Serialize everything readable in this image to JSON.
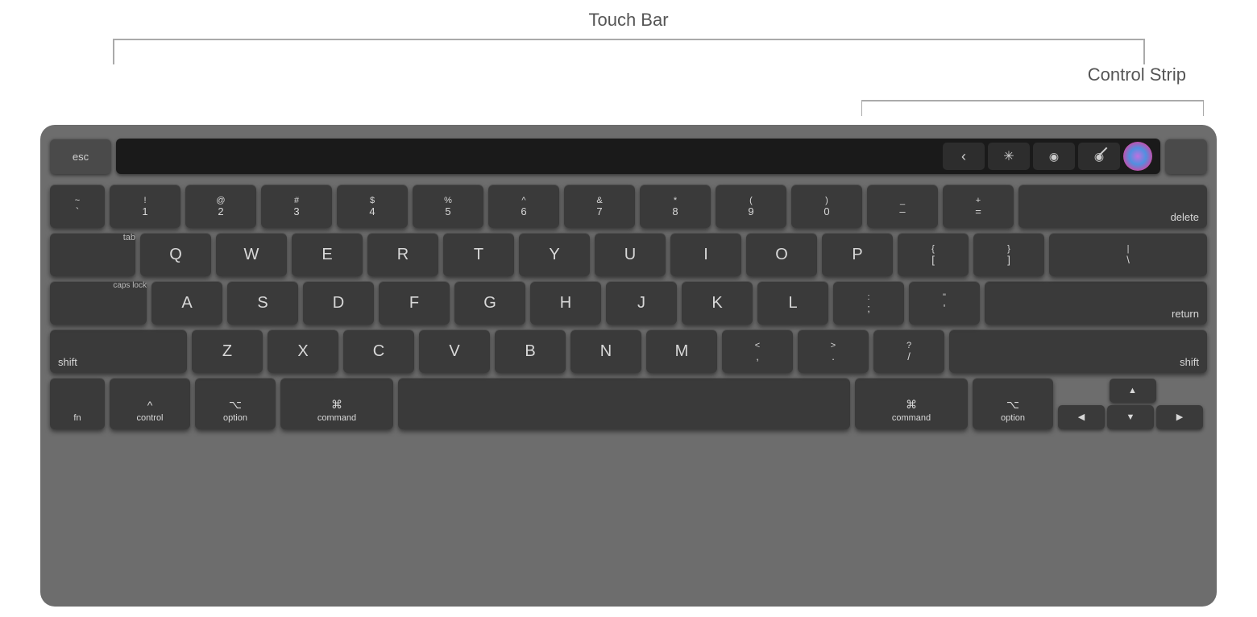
{
  "labels": {
    "touch_bar": "Touch Bar",
    "control_strip": "Control Strip"
  },
  "keyboard": {
    "touch_bar_keys": {
      "esc": "esc",
      "chevron": "‹",
      "brightness": "☀",
      "volume": "◉",
      "mute": "🔇",
      "siri": "⬤",
      "power": ""
    },
    "number_row": [
      {
        "top": "~",
        "bot": "`"
      },
      {
        "top": "!",
        "bot": "1"
      },
      {
        "top": "@",
        "bot": "2"
      },
      {
        "top": "#",
        "bot": "3"
      },
      {
        "top": "$",
        "bot": "4"
      },
      {
        "top": "%",
        "bot": "5"
      },
      {
        "top": "^",
        "bot": "6"
      },
      {
        "top": "&",
        "bot": "7"
      },
      {
        "top": "*",
        "bot": "8"
      },
      {
        "top": "(",
        "bot": "9"
      },
      {
        "top": ")",
        "bot": "0"
      },
      {
        "top": "_",
        "bot": "–"
      },
      {
        "top": "+",
        "bot": "="
      }
    ],
    "delete_label": "delete",
    "tab_label": "tab",
    "qwerty_row": [
      "Q",
      "W",
      "E",
      "R",
      "T",
      "Y",
      "U",
      "I",
      "O",
      "P"
    ],
    "bracket_row": [
      "{",
      "}",
      "\\"
    ],
    "bracket_row_bot": [
      "[",
      "]",
      "|"
    ],
    "caps_label": "caps lock",
    "asdf_row": [
      "A",
      "S",
      "D",
      "F",
      "G",
      "H",
      "J",
      "K",
      "L"
    ],
    "semicolon_row": [
      {
        "top": ":",
        "bot": ";"
      },
      {
        "top": "\"",
        "bot": "'"
      }
    ],
    "return_label": "return",
    "shift_label": "shift",
    "zxcv_row": [
      "Z",
      "X",
      "C",
      "V",
      "B",
      "N",
      "M"
    ],
    "comma_row": [
      {
        "top": "<",
        "bot": ","
      },
      {
        "top": ">",
        "bot": "."
      },
      {
        "top": "?",
        "bot": "/"
      }
    ],
    "shift_right_label": "shift",
    "fn_label": "fn",
    "control_sym": "^",
    "control_label": "control",
    "option_sym": "⌥",
    "option_label": "option",
    "command_sym": "⌘",
    "command_label": "command",
    "command_r_sym": "⌘",
    "command_r_label": "command",
    "option_r_sym": "⌥",
    "option_r_label": "option",
    "arrow_up": "▲",
    "arrow_down": "▼",
    "arrow_left": "◀",
    "arrow_right": "▶"
  }
}
